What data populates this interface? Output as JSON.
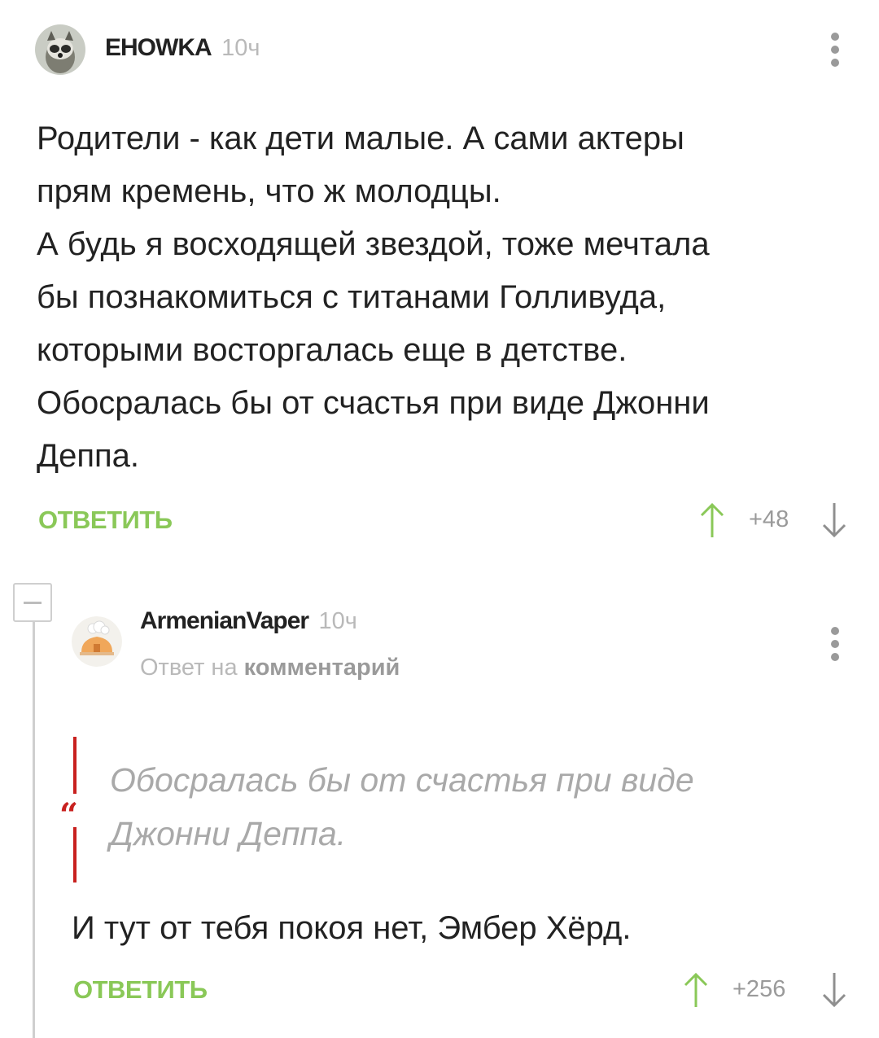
{
  "comment1": {
    "author": "EHOWKA",
    "time": "10ч",
    "text": "Родители - как дети малые. А сами актеры\nпрям кремень, что ж молодцы.\nА будь я восходящей звездой, тоже мечтала\nбы познакомиться с титанами Голливуда,\nкоторыми восторгалась еще в детстве.\nОбосралась бы от счастья при виде Джонни\nДеппа.",
    "reply_label": "ОТВЕТИТЬ",
    "rating": "+48",
    "menu_icon": "more-vertical-icon",
    "avatar_icon": "raccoon-avatar"
  },
  "comment2": {
    "author": "ArmenianVaper",
    "time": "10ч",
    "reply_to_prefix": "Ответ на",
    "reply_to_link": "комментарий",
    "quote": "Обосралась бы от счастья при виде Джонни Деппа.",
    "text": "И тут от тебя покоя нет, Эмбер Хёрд.",
    "reply_label": "ОТВЕТИТЬ",
    "rating": "+256",
    "menu_icon": "more-vertical-icon",
    "avatar_icon": "cartoon-house-avatar"
  },
  "colors": {
    "accent_green": "#8ac858",
    "quote_red": "#c8211f",
    "muted_gray": "#b9b9b9"
  }
}
